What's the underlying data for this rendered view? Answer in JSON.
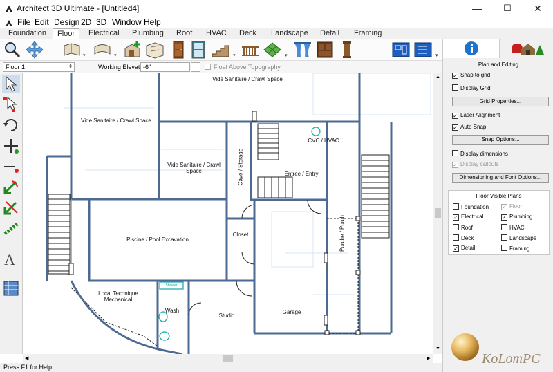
{
  "window": {
    "title": "Architect 3D Ultimate - [Untitled4]",
    "minimize": "—",
    "maximize": "☐",
    "close": "✕"
  },
  "menu": [
    "File",
    "Edit",
    "Design",
    "2D",
    "3D",
    "Window",
    "Help"
  ],
  "tabs": [
    "Foundation",
    "Floor",
    "Electrical",
    "Plumbing",
    "Roof",
    "HVAC",
    "Deck",
    "Landscape",
    "Detail",
    "Framing"
  ],
  "active_tab": "Floor",
  "toolbar": {
    "icons": [
      "magnifier-icon",
      "pan-icon",
      "open-wall-icon",
      "curved-wall-icon",
      "room-add-icon",
      "floor-plan-icon",
      "door-icon",
      "window-icon",
      "stairs-icon",
      "railing-icon",
      "floor-tile-icon",
      "curtain-icon",
      "cabinet-icon",
      "column-icon",
      "plan-view-icon",
      "plan-options-icon"
    ],
    "dropdown": "▾"
  },
  "subbar": {
    "floor_select": "Floor 1",
    "elevation_label": "Working Elevation:",
    "elevation_value": "-6\"",
    "float_label": "Float Above Topography"
  },
  "left_tools": [
    "select-arrow-icon",
    "multi-select-icon",
    "rotate-icon",
    "add-point-icon",
    "measure-line-icon",
    "angle-arrow-icon",
    "trim-arrow-icon",
    "chain-icon",
    "text-tool-icon",
    "library-icon"
  ],
  "rooms": [
    "Vide Sanitaire / Crawl Space",
    "Vide Sanitaire / Crawl Space",
    "Vide Sanitaire / Crawl Space",
    "CVC / HVAC",
    "Entree / Entry",
    "Cave / Storage",
    "Piscine / Pool Excavation",
    "Closet",
    "Porche / Porch",
    "Local Technique Mechanical",
    "Wash",
    "Studio",
    "Garage",
    "Shower"
  ],
  "status": "Press F1 for Help",
  "right_panel": {
    "section_title": "Plan and Editing",
    "checks": [
      {
        "label": "Snap to grid",
        "checked": true
      },
      {
        "label": "Display Grid",
        "checked": false
      }
    ],
    "grid_button": "Grid Properties...",
    "checks2": [
      {
        "label": "Laser Alignment",
        "checked": true
      },
      {
        "label": "Auto Snap",
        "checked": true
      }
    ],
    "snap_button": "Snap Options...",
    "checks3": [
      {
        "label": "Display dimensions",
        "checked": false
      },
      {
        "label": "Display callouts",
        "checked": true
      }
    ],
    "dim_button": "Dimensioning and Font Options...",
    "floor_visible_title": "Floor Visible Plans",
    "plans_left": [
      {
        "label": "Foundation",
        "checked": false
      },
      {
        "label": "Electrical",
        "checked": true
      },
      {
        "label": "Roof",
        "checked": false
      },
      {
        "label": "Deck",
        "checked": false
      },
      {
        "label": "Detail",
        "checked": true
      }
    ],
    "plans_right": [
      {
        "label": "Floor",
        "checked": true
      },
      {
        "label": "Plumbing",
        "checked": true
      },
      {
        "label": "HVAC",
        "checked": false
      },
      {
        "label": "Landscape",
        "checked": false
      },
      {
        "label": "Framing",
        "checked": false
      }
    ]
  },
  "watermark": "KoLomPC",
  "colors": {
    "wall": "#4d6a92",
    "wall_light": "#7f9fcc",
    "accent": "#1e73c8",
    "panel_bg": "#f0f0f0"
  }
}
